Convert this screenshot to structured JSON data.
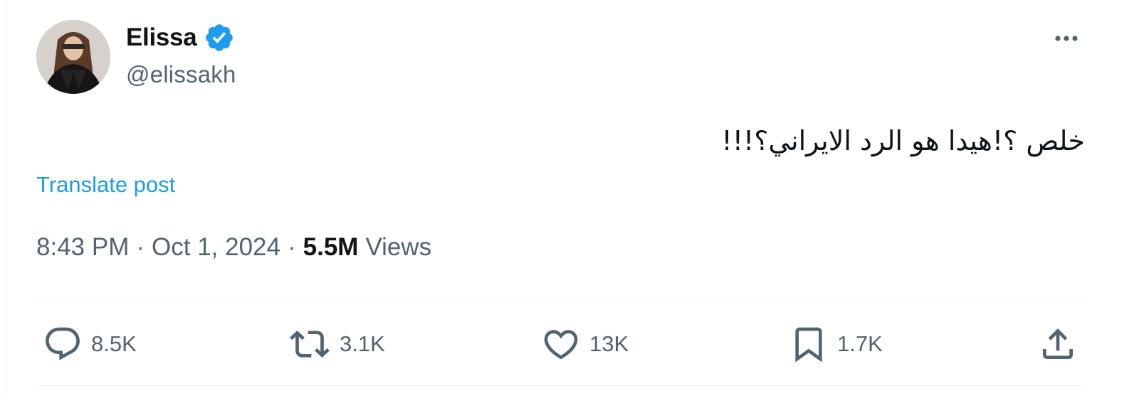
{
  "author": {
    "display_name": "Elissa",
    "handle": "@elissakh",
    "verified": true,
    "avatar_icon": "profile-photo"
  },
  "post": {
    "text": "خلص ؟!هيدا هو الرد الايراني؟!!!",
    "translate_label": "Translate post",
    "time": "8:43 PM",
    "date": "Oct 1, 2024",
    "separator": "·",
    "views_count": "5.5M",
    "views_label": "Views"
  },
  "actions": {
    "replies": "8.5K",
    "reposts": "3.1K",
    "likes": "13K",
    "bookmarks": "1.7K"
  },
  "icons": {
    "more": "more-horizontal-icon",
    "verified": "verified-badge-icon",
    "reply": "reply-icon",
    "repost": "repost-icon",
    "like": "heart-icon",
    "bookmark": "bookmark-icon",
    "share": "share-icon"
  },
  "colors": {
    "accent": "#1d9bf0",
    "text": "#0f1419",
    "secondary": "#536471",
    "divider": "#eff3f4"
  }
}
